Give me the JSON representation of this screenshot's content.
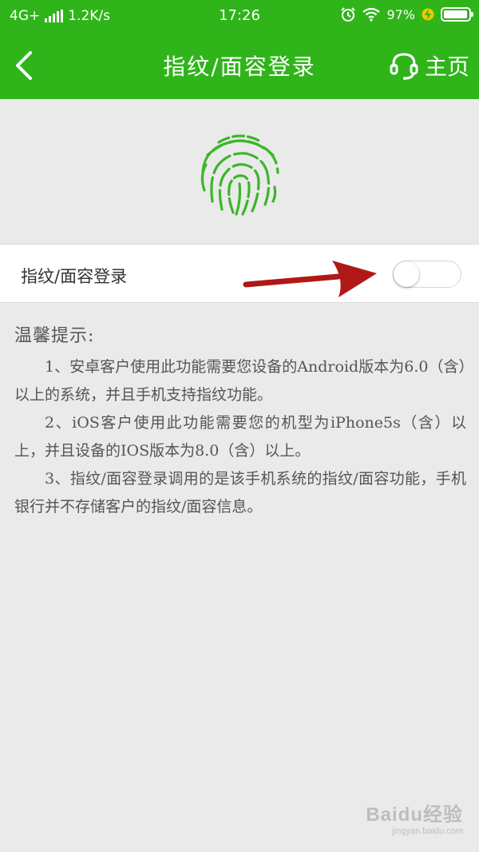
{
  "status_bar": {
    "network": "4G+",
    "speed": "1.2K/s",
    "time": "17:26",
    "battery": "97%",
    "battery_level": 0.97
  },
  "header": {
    "title": "指纹/面容登录",
    "home_label": "主页"
  },
  "toggle": {
    "label": "指纹/面容登录",
    "enabled": false
  },
  "tips": {
    "title": "温馨提示:",
    "items": [
      "1、安卓客户使用此功能需要您设备的Android版本为6.0（含）以上的系统，并且手机支持指纹功能。",
      "2、iOS客户使用此功能需要您的机型为iPhone5s（含）以上，并且设备的IOS版本为8.0（含）以上。",
      "3、指纹/面容登录调用的是该手机系统的指纹/面容功能，手机银行并不存储客户的指纹/面容信息。"
    ]
  },
  "watermark": {
    "logo": "Baidu经验",
    "url": "jingyan.baidu.com"
  },
  "colors": {
    "brand_green": "#2fb51a",
    "fingerprint_green": "#3cb52a",
    "arrow_red": "#b01818",
    "background": "#eaeaea"
  },
  "icons": {
    "back": "chevron-left-icon",
    "home": "headset-icon",
    "fingerprint": "fingerprint-icon",
    "annotation": "red-arrow-icon"
  }
}
